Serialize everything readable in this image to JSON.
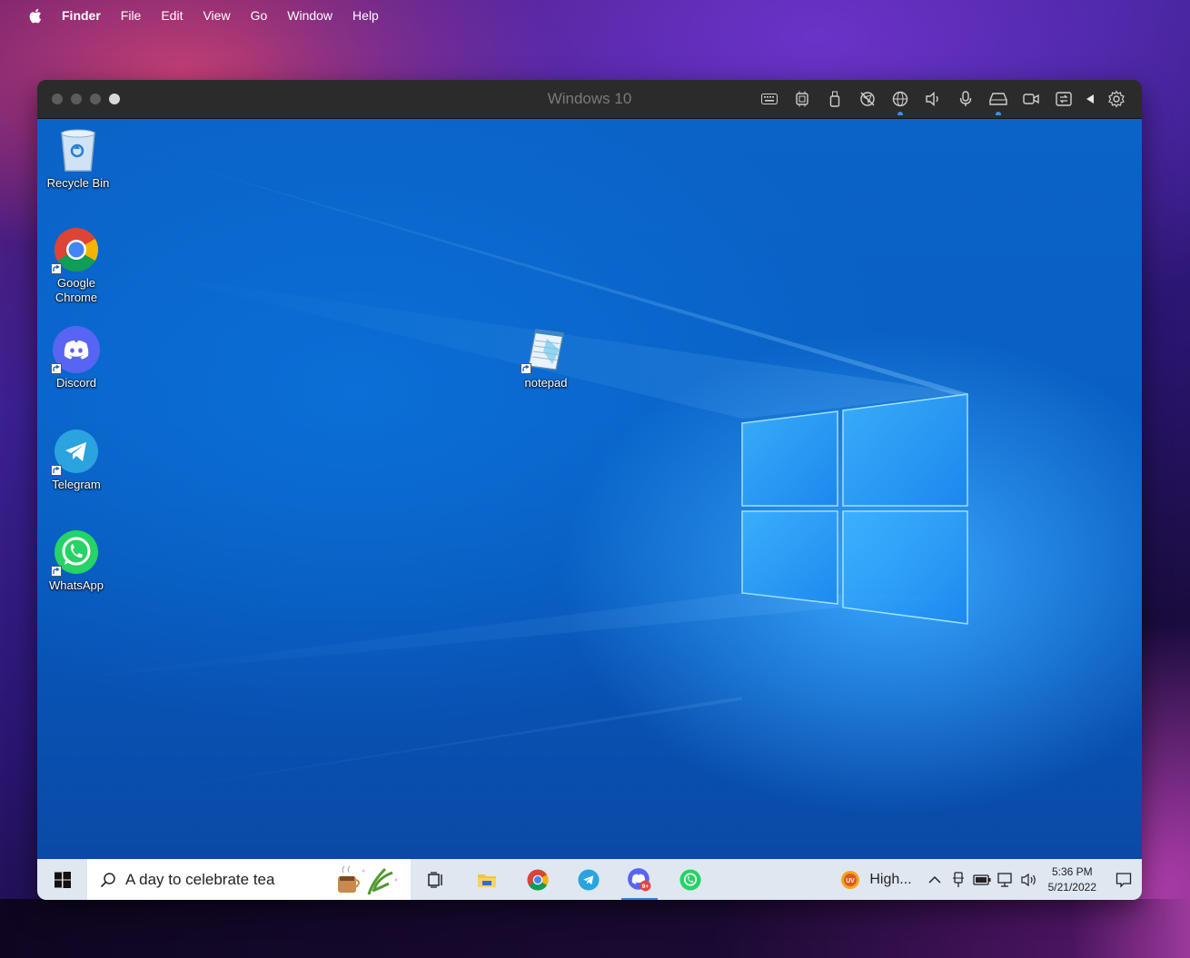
{
  "mac_menubar": {
    "app_name": "Finder",
    "items": [
      "File",
      "Edit",
      "View",
      "Go",
      "Window",
      "Help"
    ]
  },
  "vm_window": {
    "title": "Windows 10",
    "toolbar_icons": [
      "keyboard-icon",
      "cpu-icon",
      "usb-icon",
      "location-off-icon",
      "network-icon",
      "speaker-icon",
      "microphone-icon",
      "disk-icon",
      "camera-icon",
      "share-icon",
      "collapse-arrow-icon",
      "settings-icon"
    ]
  },
  "desktop_icons": [
    {
      "label": "Recycle Bin"
    },
    {
      "label": "Google Chrome"
    },
    {
      "label": "Discord"
    },
    {
      "label": "Telegram"
    },
    {
      "label": "WhatsApp"
    },
    {
      "label": "notepad"
    }
  ],
  "taskbar": {
    "search_text": "A day to celebrate tea",
    "pinned": [
      "task-view-icon",
      "file-explorer-icon",
      "chrome-icon",
      "telegram-icon",
      "discord-icon",
      "whatsapp-icon"
    ],
    "discord_badge": "9+",
    "weather_text": "High...",
    "uv_label": "UV",
    "time": "5:36 PM",
    "date": "5/21/2022"
  },
  "colors": {
    "win_blue": "#0a5fc4",
    "taskbar_bg": "#dfe7f1",
    "accent": "#3b78d8"
  }
}
